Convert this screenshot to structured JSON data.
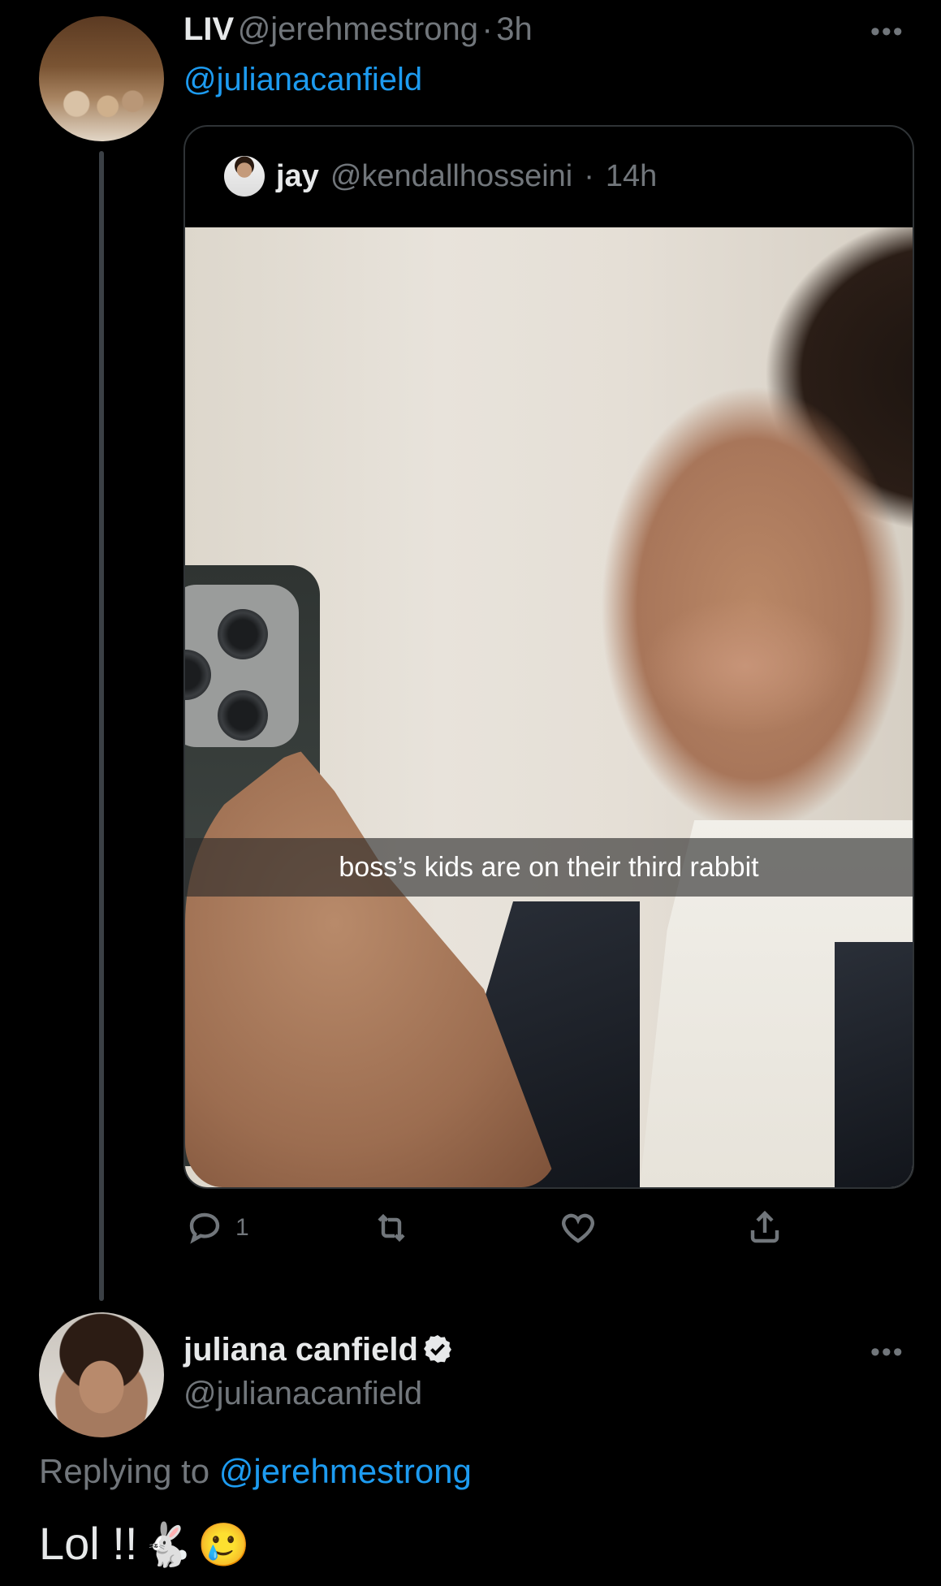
{
  "tweet_liv": {
    "display_name": "LIV",
    "handle": "@jerehmestrong",
    "separator": "·",
    "time": "3h",
    "mention": "@julianacanfield",
    "more_icon": "more-horizontal-icon"
  },
  "quoted_tweet": {
    "display_name": "jay",
    "handle": "@kendallhosseini",
    "separator": "·",
    "time": "14h",
    "image_caption": "boss’s kids are on their third rabbit"
  },
  "actions": {
    "reply_count": "1",
    "reply_icon": "comment-icon",
    "retweet_icon": "retweet-icon",
    "like_icon": "heart-icon",
    "share_icon": "share-icon"
  },
  "tweet_juliana": {
    "display_name": "juliana canfield",
    "verified_icon": "verified-badge-icon",
    "handle": "@julianacanfield",
    "replying_prefix": "Replying to",
    "replying_to": "@jerehmestrong",
    "text": "Lol !!",
    "emoji_1": "🐇",
    "emoji_2": "🥲",
    "more_icon": "more-horizontal-icon"
  },
  "colors": {
    "background": "#000000",
    "link": "#1d9bf0",
    "muted": "#71767b",
    "text": "#e7e9ea"
  }
}
